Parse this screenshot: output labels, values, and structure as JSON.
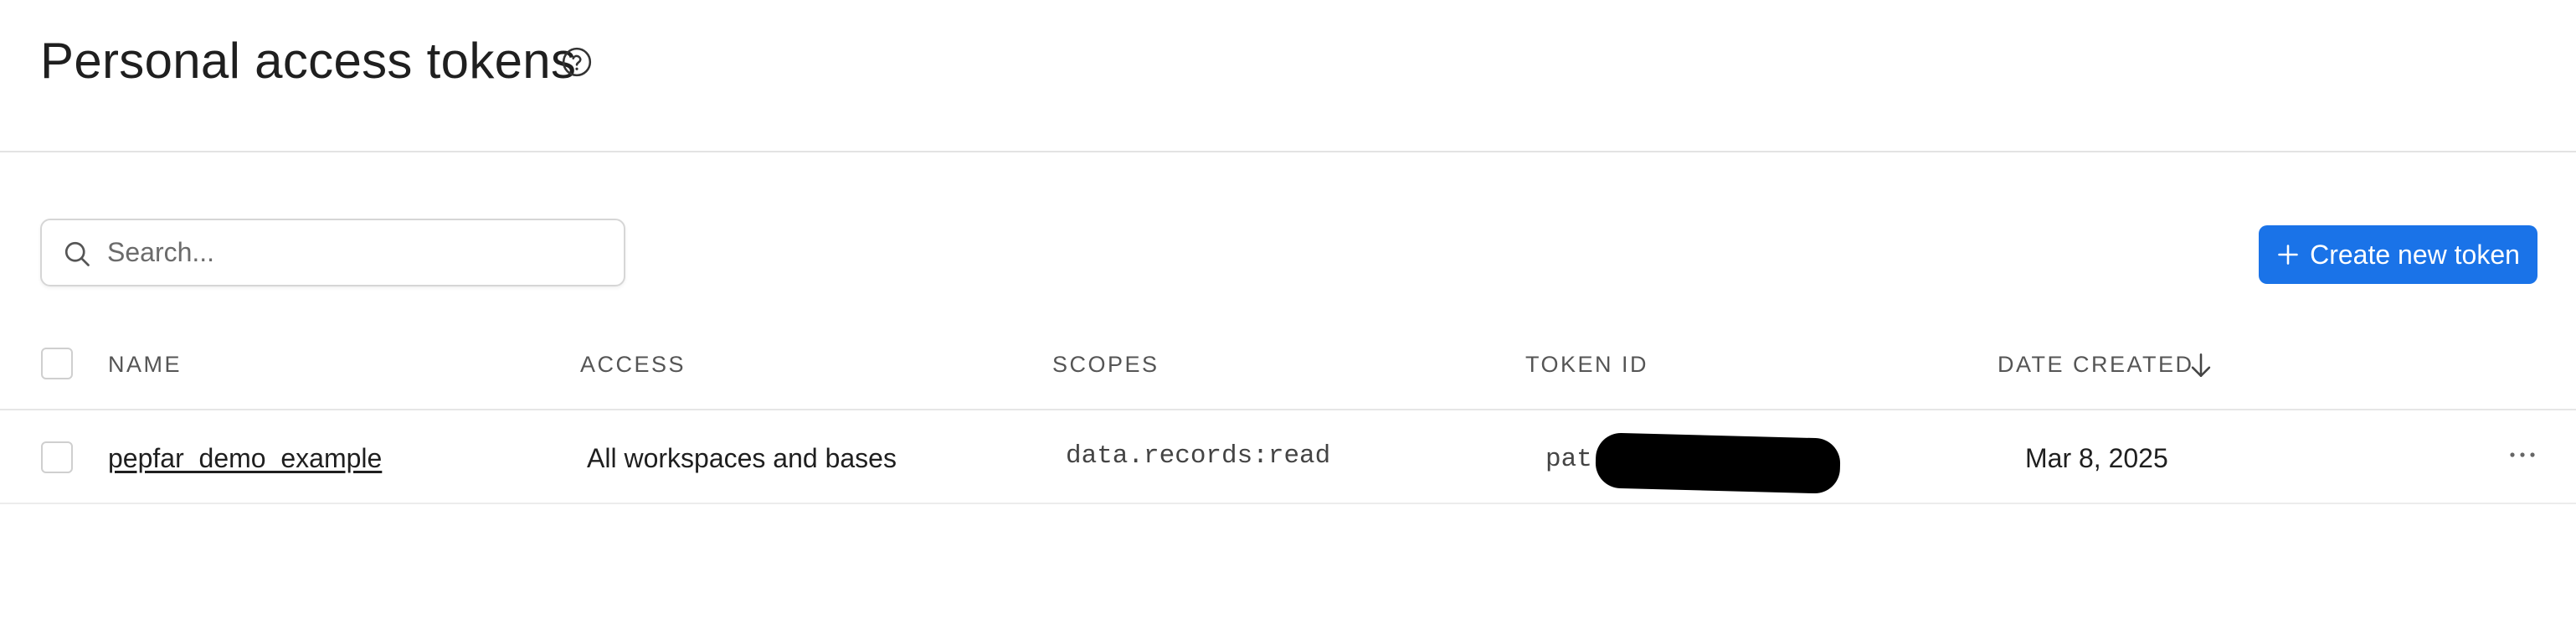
{
  "header": {
    "title": "Personal access tokens",
    "help_icon": "question-circle-icon"
  },
  "toolbar": {
    "search_placeholder": "Search...",
    "search_value": "",
    "create_label": "Create new token",
    "accent_color": "#1a73e8"
  },
  "table": {
    "columns": [
      "NAME",
      "ACCESS",
      "SCOPES",
      "TOKEN ID",
      "DATE CREATED"
    ],
    "sort": {
      "column": "DATE CREATED",
      "direction": "descending"
    },
    "rows": [
      {
        "name": "pepfar_demo_example",
        "access": "All workspaces and bases",
        "scopes": "data.records:read",
        "token_id_prefix": "pat",
        "token_id_redacted": true,
        "date_created": "Mar 8, 2025"
      }
    ]
  }
}
